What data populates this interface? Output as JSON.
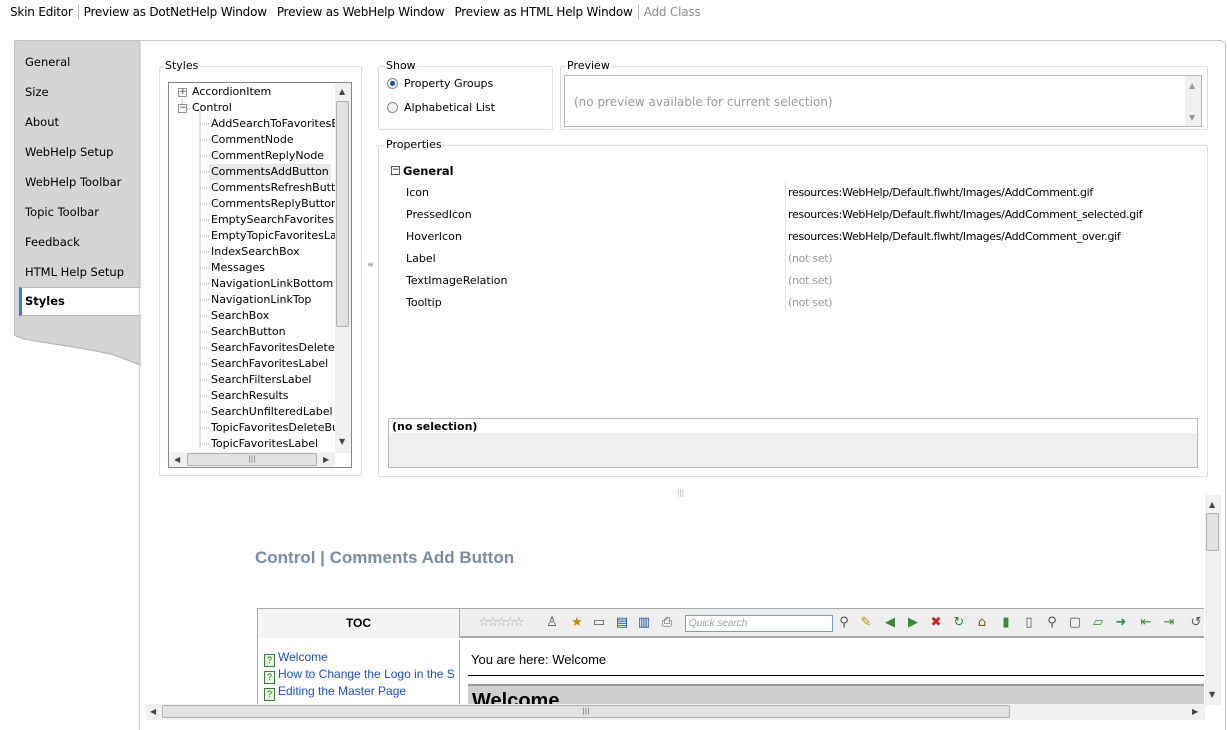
{
  "toolbar": {
    "skin_editor": "Skin Editor",
    "preview_dotnet": "Preview as DotNetHelp Window",
    "preview_webhelp": "Preview as WebHelp Window",
    "preview_html": "Preview as HTML Help Window",
    "add_class": "Add Class"
  },
  "sidebar": {
    "items": [
      "General",
      "Size",
      "About",
      "WebHelp Setup",
      "WebHelp Toolbar",
      "Topic Toolbar",
      "Feedback",
      "HTML Help Setup"
    ],
    "active": "Styles"
  },
  "styles": {
    "label": "Styles",
    "tree": {
      "nodes": [
        "AccordionItem",
        "Control"
      ],
      "children": [
        "AddSearchToFavoritesBu",
        "CommentNode",
        "CommentReplyNode",
        "CommentsAddButton",
        "CommentsRefreshButton",
        "CommentsReplyButton",
        "EmptySearchFavoritesLab",
        "EmptyTopicFavoritesLabe",
        "IndexSearchBox",
        "Messages",
        "NavigationLinkBottom",
        "NavigationLinkTop",
        "SearchBox",
        "SearchButton",
        "SearchFavoritesDeleteBu",
        "SearchFavoritesLabel",
        "SearchFiltersLabel",
        "SearchResults",
        "SearchUnfilteredLabel",
        "TopicFavoritesDeleteButt",
        "TopicFavoritesLabel"
      ],
      "selected": "CommentsAddButton",
      "plus": "+",
      "minus": "−"
    }
  },
  "show": {
    "label": "Show",
    "options": [
      "Property Groups",
      "Alphabetical List"
    ],
    "selected": "Property Groups"
  },
  "preview": {
    "label": "Preview",
    "text": "(no preview available for current selection)"
  },
  "properties": {
    "label": "Properties",
    "group": "General",
    "rows": [
      {
        "name": "Icon",
        "value": "resources:WebHelp/Default.flwht/Images/AddComment.gif",
        "set": true
      },
      {
        "name": "PressedIcon",
        "value": "resources:WebHelp/Default.flwht/Images/AddComment_selected.gif",
        "set": true
      },
      {
        "name": "HoverIcon",
        "value": "resources:WebHelp/Default.flwht/Images/AddComment_over.gif",
        "set": true
      },
      {
        "name": "Label",
        "value": "(not set)",
        "set": false
      },
      {
        "name": "TextImageRelation",
        "value": "(not set)",
        "set": false
      },
      {
        "name": "Tooltip",
        "value": "(not set)",
        "set": false
      }
    ],
    "description": "(no selection)"
  },
  "webpreview": {
    "title": "Control | Comments Add Button",
    "toc_label": "TOC",
    "search_placeholder": "Quick search",
    "toc_items": [
      "Welcome",
      "How to Change the Logo in the S",
      "Editing the Master Page"
    ],
    "breadcrumb": "You are here: Welcome",
    "heading": "Welcome"
  },
  "scrollbar": {
    "grip": "|||"
  }
}
